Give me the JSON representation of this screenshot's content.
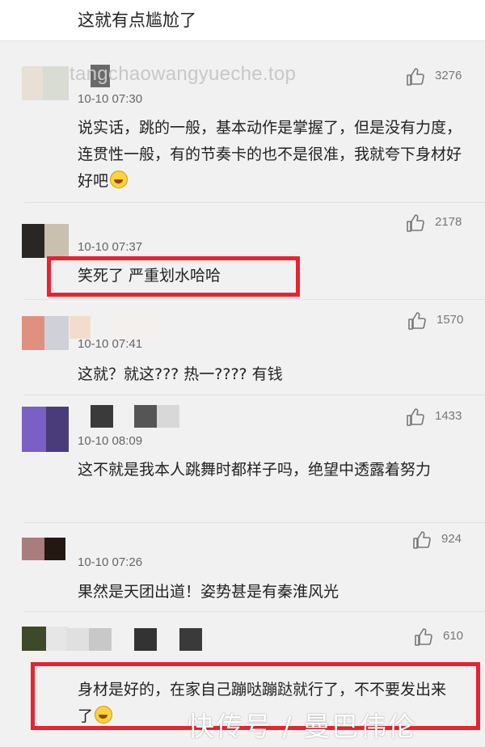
{
  "header": {
    "title": "这就有点尴尬了"
  },
  "watermark": "tangchaowangyueche.top",
  "comments": [
    {
      "time": "10-10 07:30",
      "likes": "3276",
      "text": "说实话，跳的一般，基本动作是掌握了，但是没有力度，连贯性一般，有的节奏卡的也不是很准，我就夸下身材好好吧"
    },
    {
      "time": "10-10 07:37",
      "likes": "2178",
      "text": "笑死了 严重划水哈哈"
    },
    {
      "time": "10-10 07:41",
      "likes": "1570",
      "text": "这就？就这??? 热一???? 有钱"
    },
    {
      "time": "10-10 08:09",
      "likes": "1433",
      "text": "这不就是我本人跳舞时都样子吗，绝望中透露着努力"
    },
    {
      "time": "10-10 07:26",
      "likes": "924",
      "text": "果然是天团出道！姿势甚是有秦淮风光"
    },
    {
      "time": "",
      "likes": "610",
      "text": "身材是好的，在家自己蹦哒蹦跶就行了，不不要发出来了"
    }
  ],
  "footer_watermark": "快传号 / 曼巴伟伦",
  "colors": {
    "highlight": "#e8232f",
    "background": "#f1f1f1",
    "text": "#222222",
    "meta": "#666666"
  },
  "icons": {
    "like": "thumbs-up-icon",
    "emoji": "laughing-emoji-icon"
  }
}
